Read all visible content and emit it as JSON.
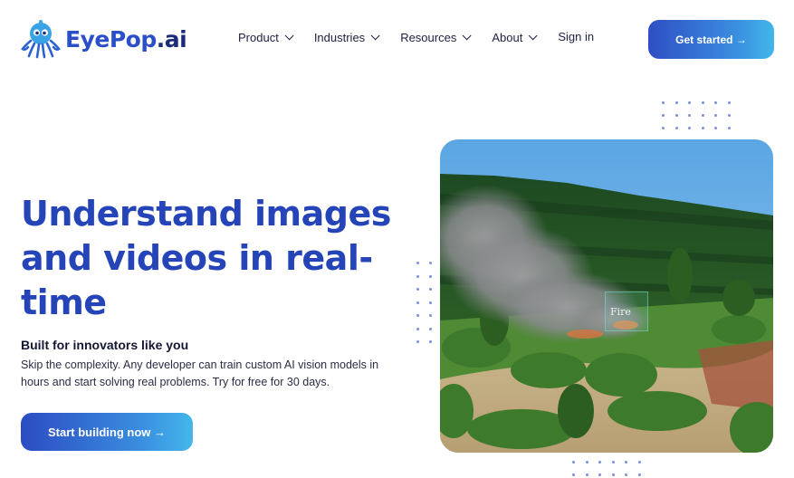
{
  "brand": {
    "name_main": "EyePop",
    "name_suffix": ".ai"
  },
  "nav": {
    "items": [
      {
        "label": "Product"
      },
      {
        "label": "Industries"
      },
      {
        "label": "Resources"
      },
      {
        "label": "About"
      }
    ],
    "signin": "Sign in",
    "cta": "Get started →"
  },
  "hero": {
    "headline": "Understand images and videos in real-time",
    "subhead": "Built for innovators like you",
    "description": "Skip the complexity. Any developer can train custom AI vision models in hours and start solving real problems. Try for free for 30 days.",
    "cta": "Start building now →",
    "image": {
      "detection_label": "Fire"
    }
  },
  "colors": {
    "brand_blue": "#2444b8",
    "gradient_start": "#2c4cc2",
    "gradient_end": "#43b7eb",
    "dot_color": "#7d8fe0"
  }
}
